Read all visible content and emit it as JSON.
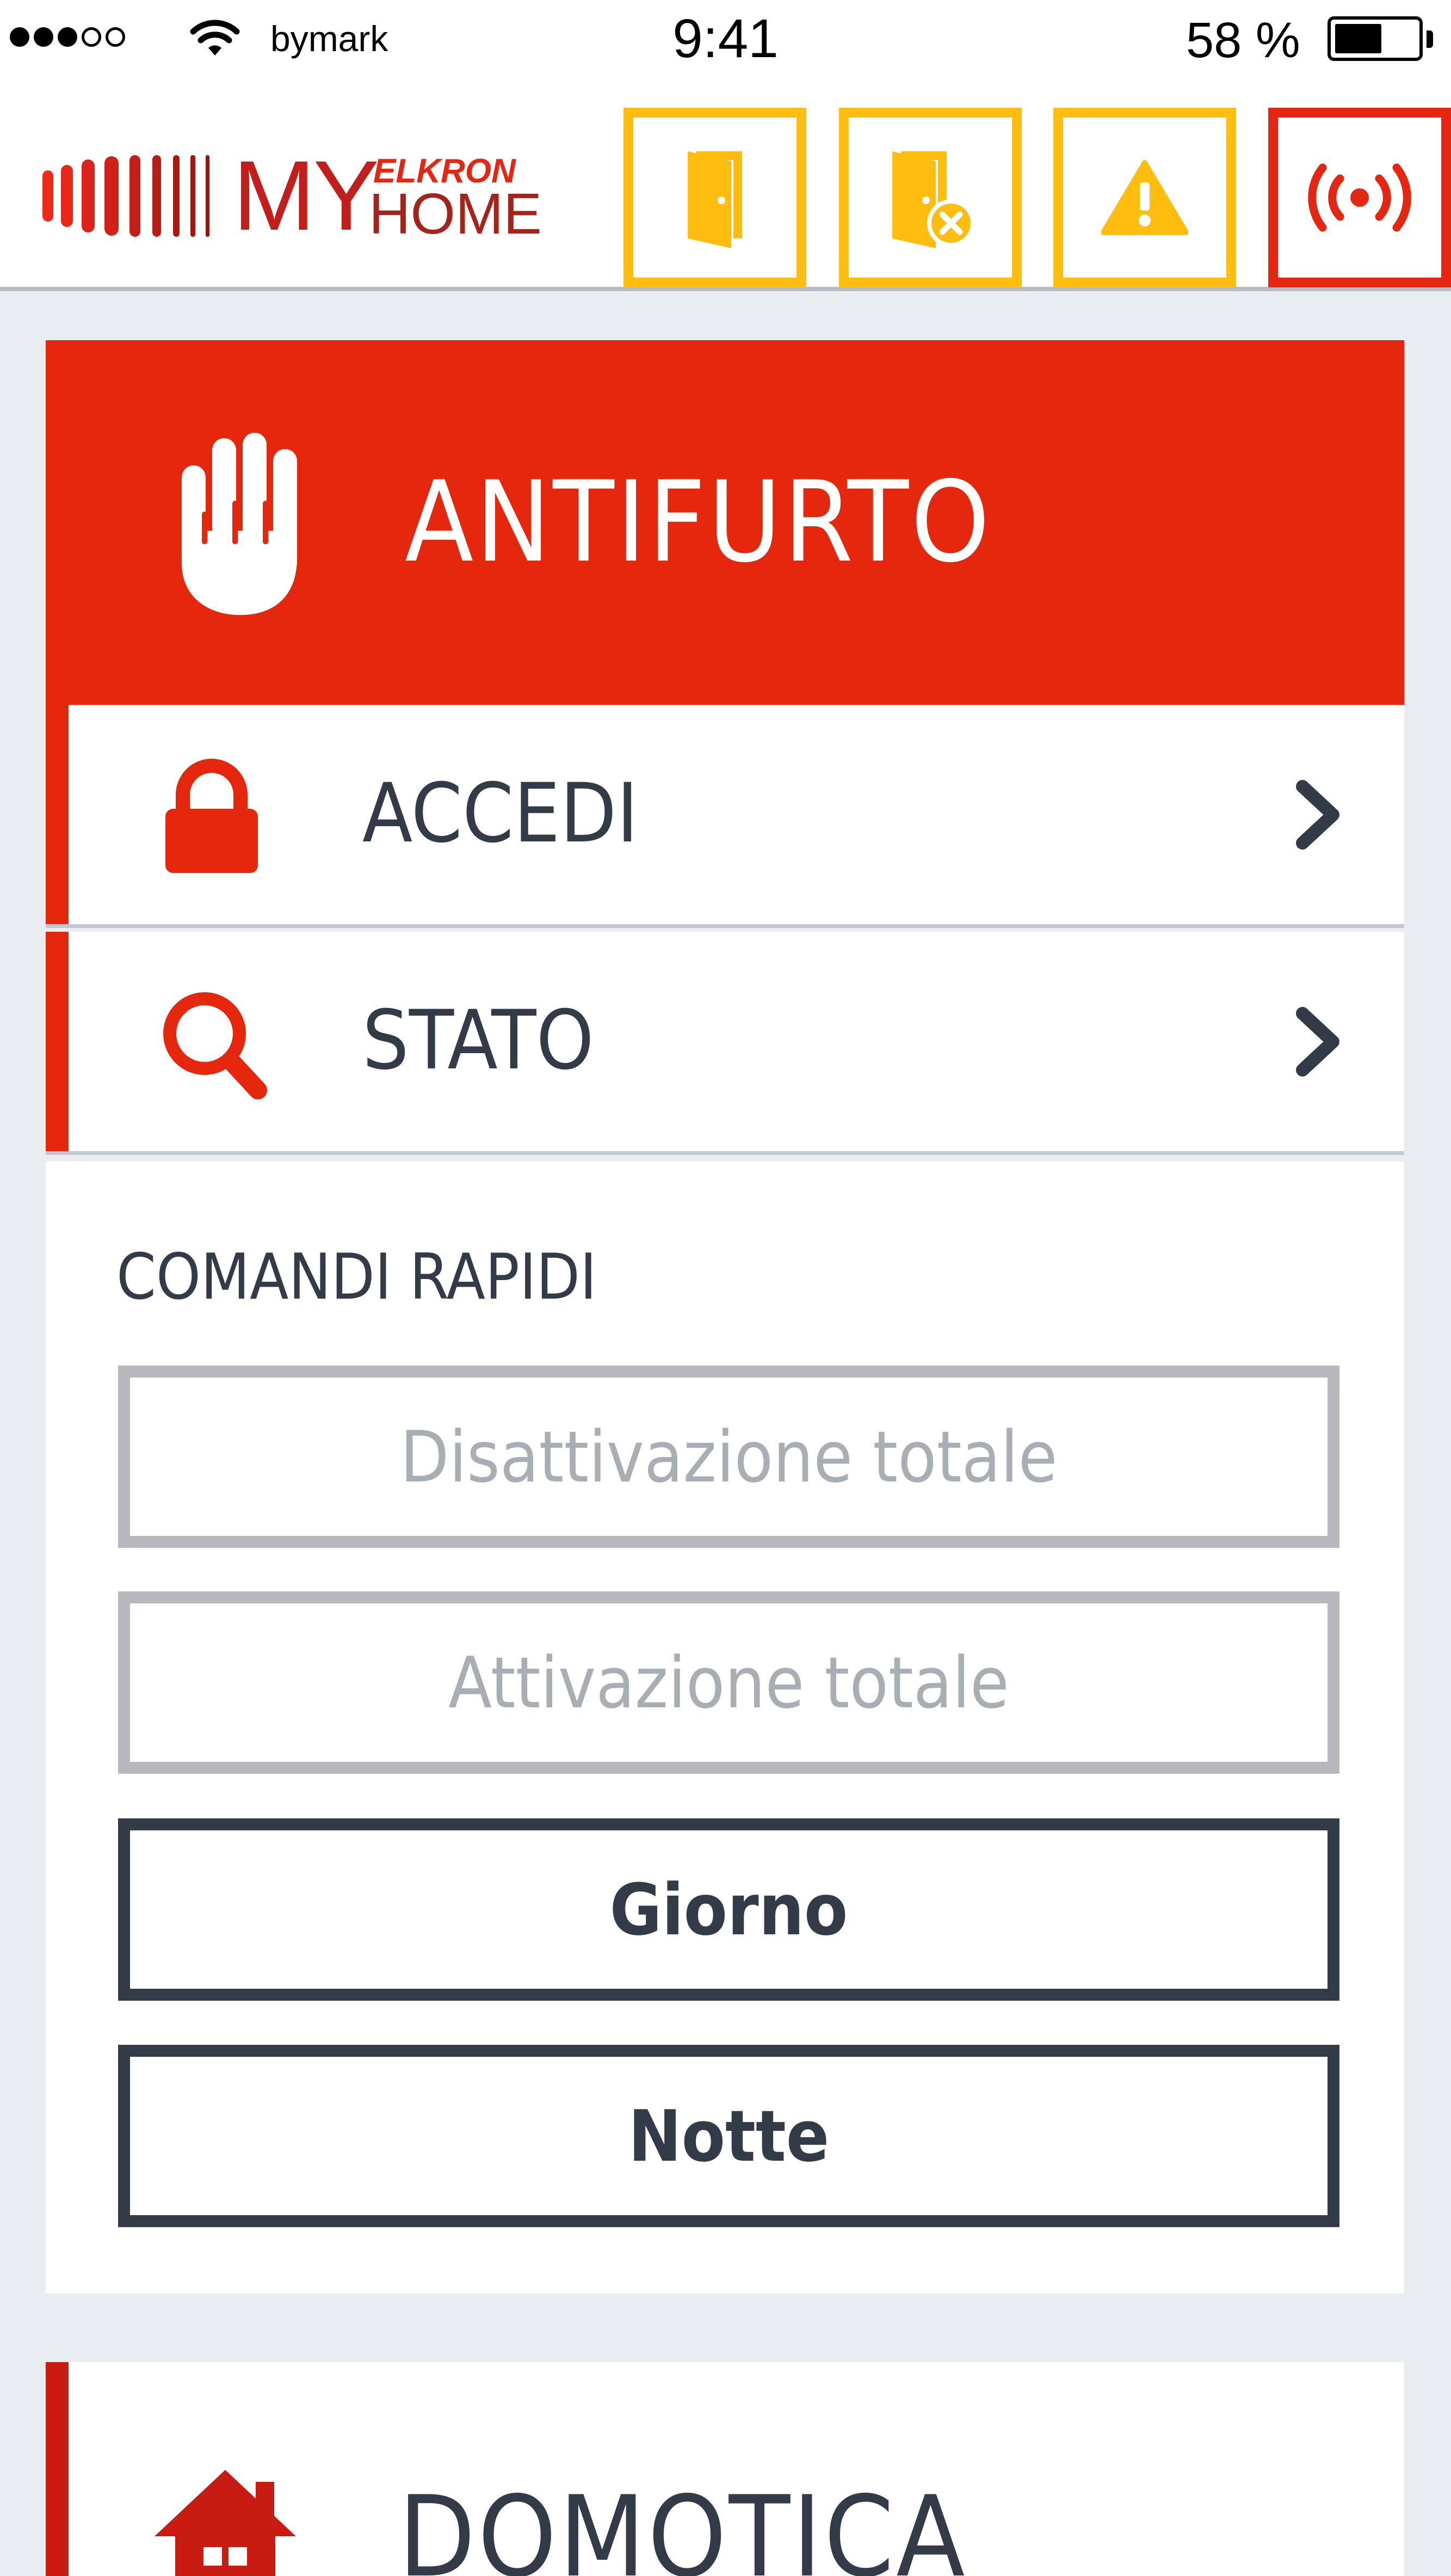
{
  "status_bar": {
    "carrier": "bymark",
    "time": "9:41",
    "battery_percent": "58 %",
    "battery_level": 0.58,
    "signal_bars_filled": 3,
    "signal_bars_total": 5
  },
  "header": {
    "logo": {
      "my": "MY",
      "elkron": "ELKRON",
      "home": "HOME"
    },
    "buttons": [
      {
        "icon": "door-open-icon",
        "color": "#ffbe0f"
      },
      {
        "icon": "door-excluded-icon",
        "color": "#ffbe0f"
      },
      {
        "icon": "warning-icon",
        "color": "#ffbe0f"
      },
      {
        "icon": "alarm-broadcast-icon",
        "color": "#e52613"
      }
    ]
  },
  "antifurto": {
    "title": "ANTIFURTO",
    "icon": "hand-icon",
    "accent_color": "#e5270d",
    "menu": [
      {
        "label": "ACCEDI",
        "icon": "lock-icon"
      },
      {
        "label": "STATO",
        "icon": "search-icon"
      }
    ],
    "quick_commands": {
      "title": "COMANDI RAPIDI",
      "buttons": [
        {
          "label": "Disattivazione totale",
          "enabled": false
        },
        {
          "label": "Attivazione totale",
          "enabled": false
        },
        {
          "label": "Giorno",
          "enabled": true
        },
        {
          "label": "Notte",
          "enabled": true
        }
      ]
    }
  },
  "domotica": {
    "title": "DOMOTICA",
    "icon": "house-icon"
  }
}
